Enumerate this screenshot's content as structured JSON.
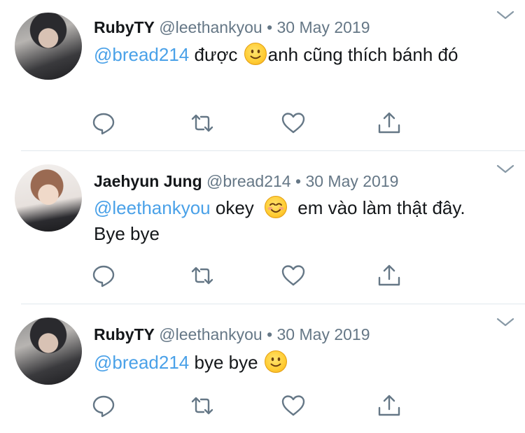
{
  "tweets": [
    {
      "name": "RubyTY",
      "handle": "@leethankyou",
      "separator": "•",
      "date": "30 May 2019",
      "mention": "@bread214",
      "text_before_emoji": "được",
      "text_after_emoji": "anh cũng thích bánh đó",
      "emoji": "slightly-smiling-face"
    },
    {
      "name": "Jaehyun Jung",
      "handle": "@bread214",
      "separator": "•",
      "date": "30 May 2019",
      "mention": "@leethankyou",
      "text_before_emoji": "okey",
      "text_after_emoji": "em vào làm thật đây. Bye bye",
      "emoji": "smiling-face-with-smiling-eyes"
    },
    {
      "name": "RubyTY",
      "handle": "@leethankyou",
      "separator": "•",
      "date": "30 May 2019",
      "mention": "@bread214",
      "text_before_emoji": "bye bye",
      "text_after_emoji": "",
      "emoji": "slightly-smiling-face"
    }
  ],
  "icons": {
    "reply": "reply-icon",
    "retweet": "retweet-icon",
    "like": "like-icon",
    "share": "share-icon",
    "menu": "chevron-down-icon"
  },
  "colors": {
    "mention": "#4aa1e8",
    "meta": "#657786",
    "icon": "#657786",
    "divider": "#e1e8ed"
  }
}
